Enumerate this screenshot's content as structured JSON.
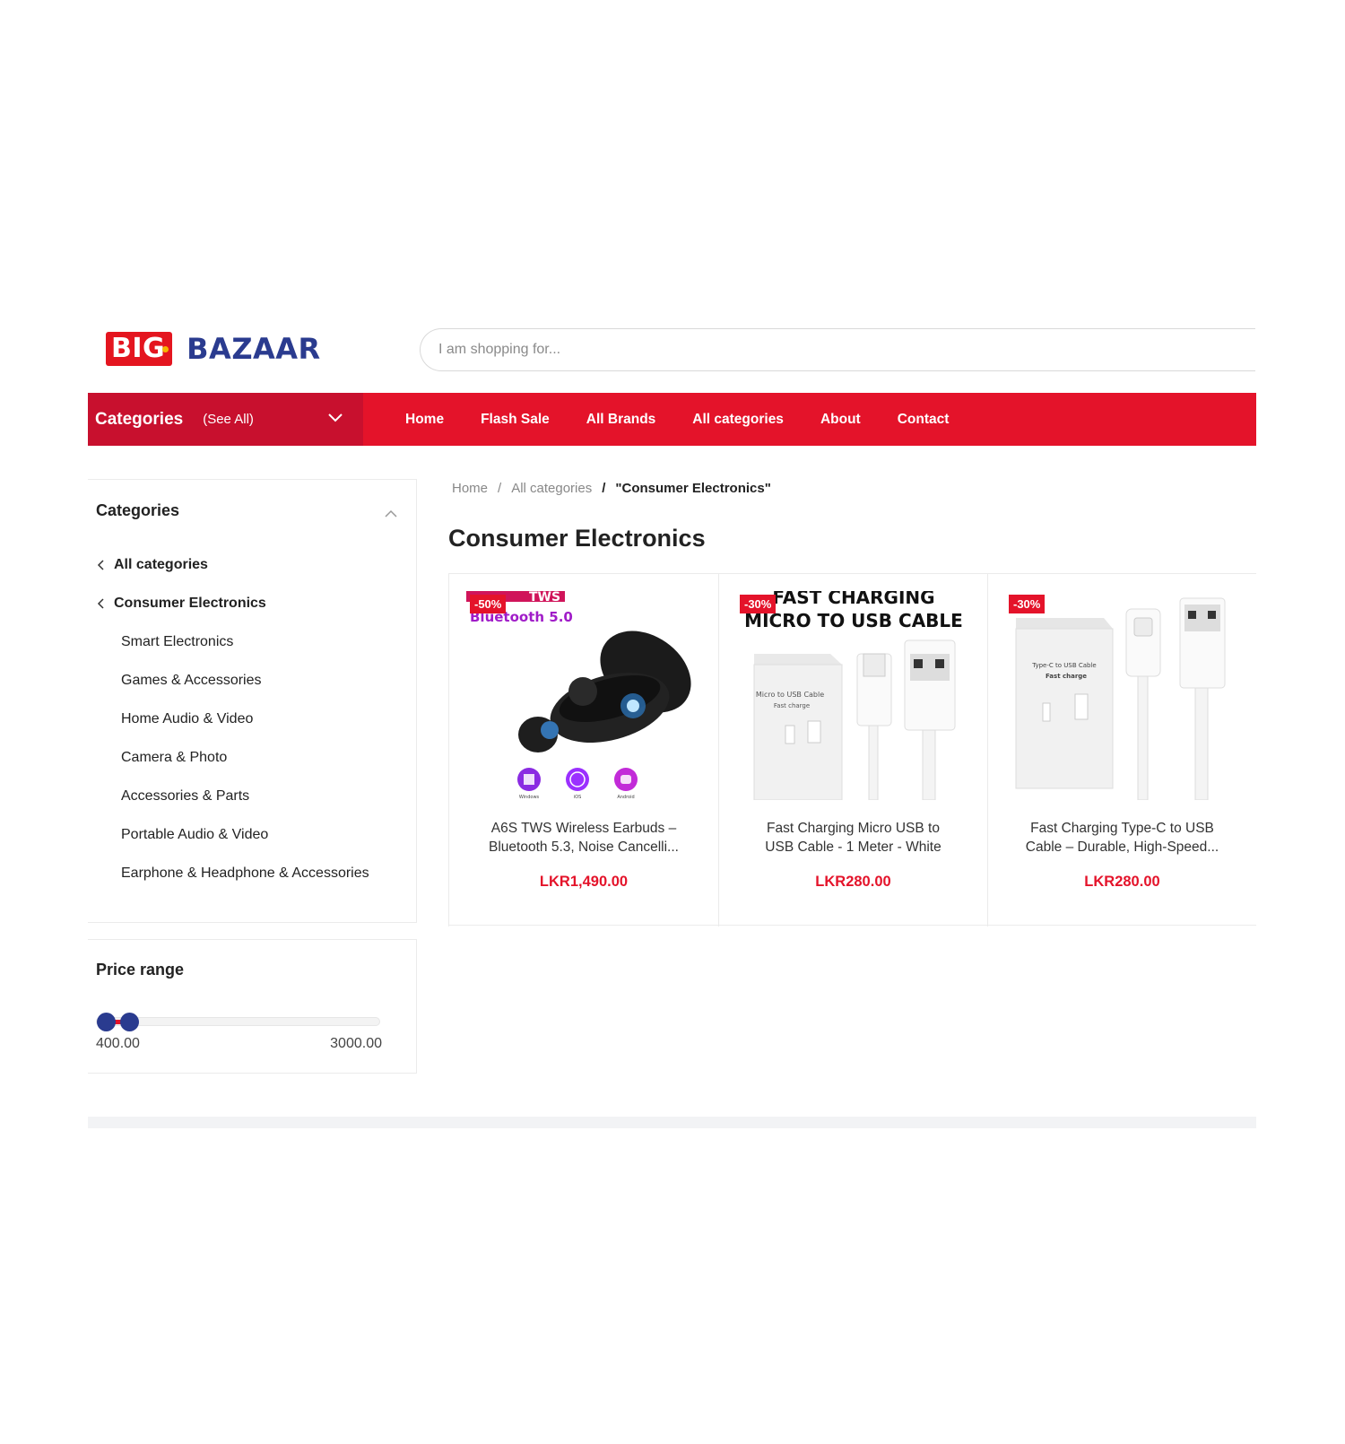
{
  "brand": {
    "part1": "BIG",
    "part2": "BAZAAR"
  },
  "search": {
    "placeholder": "I am shopping for..."
  },
  "nav": {
    "categories_label": "Categories",
    "see_all": "(See All)",
    "links": [
      "Home",
      "Flash Sale",
      "All Brands",
      "All categories",
      "About",
      "Contact"
    ]
  },
  "sidebar": {
    "categories_title": "Categories",
    "back_items": [
      "All categories",
      "Consumer Electronics"
    ],
    "sub_items": [
      "Smart Electronics",
      "Games & Accessories",
      "Home Audio & Video",
      "Camera & Photo",
      "Accessories & Parts",
      "Portable Audio & Video",
      "Earphone & Headphone & Accessories"
    ],
    "price_title": "Price range",
    "price_min": "400.00",
    "price_max": "3000.00",
    "price_range_fraction": {
      "low": 0.0,
      "high": 0.09
    }
  },
  "breadcrumb": {
    "home": "Home",
    "sep": "/",
    "all": "All categories",
    "current": "\"Consumer Electronics\""
  },
  "page_title": "Consumer Electronics",
  "products": [
    {
      "badge": "-50%",
      "name_line1": "A6S TWS Wireless Earbuds –",
      "name_line2": "Bluetooth 5.3, Noise Cancelli...",
      "price": "LKR1,490.00",
      "img_text_1": "TWS",
      "img_text_2": "Bluetooth 5.0",
      "os_labels": [
        "Windows",
        "iOS",
        "Android"
      ]
    },
    {
      "badge": "-30%",
      "name_line1": "Fast Charging Micro USB to",
      "name_line2": "USB Cable - 1 Meter - White",
      "price": "LKR280.00",
      "img_text_1": "FAST CHARGING",
      "img_text_2": "MICRO TO USB CABLE",
      "box_text": "Micro to USB Cable",
      "box_sub": "Fast charge"
    },
    {
      "badge": "-30%",
      "name_line1": "Fast Charging Type-C to USB",
      "name_line2": "Cable – Durable, High-Speed...",
      "price": "LKR280.00",
      "box_text": "Type-C to USB Cable",
      "box_sub": "Fast charge"
    }
  ],
  "colors": {
    "accent": "#e4132a",
    "accent_dark": "#c8102e",
    "brand_blue": "#2a3b8f"
  }
}
